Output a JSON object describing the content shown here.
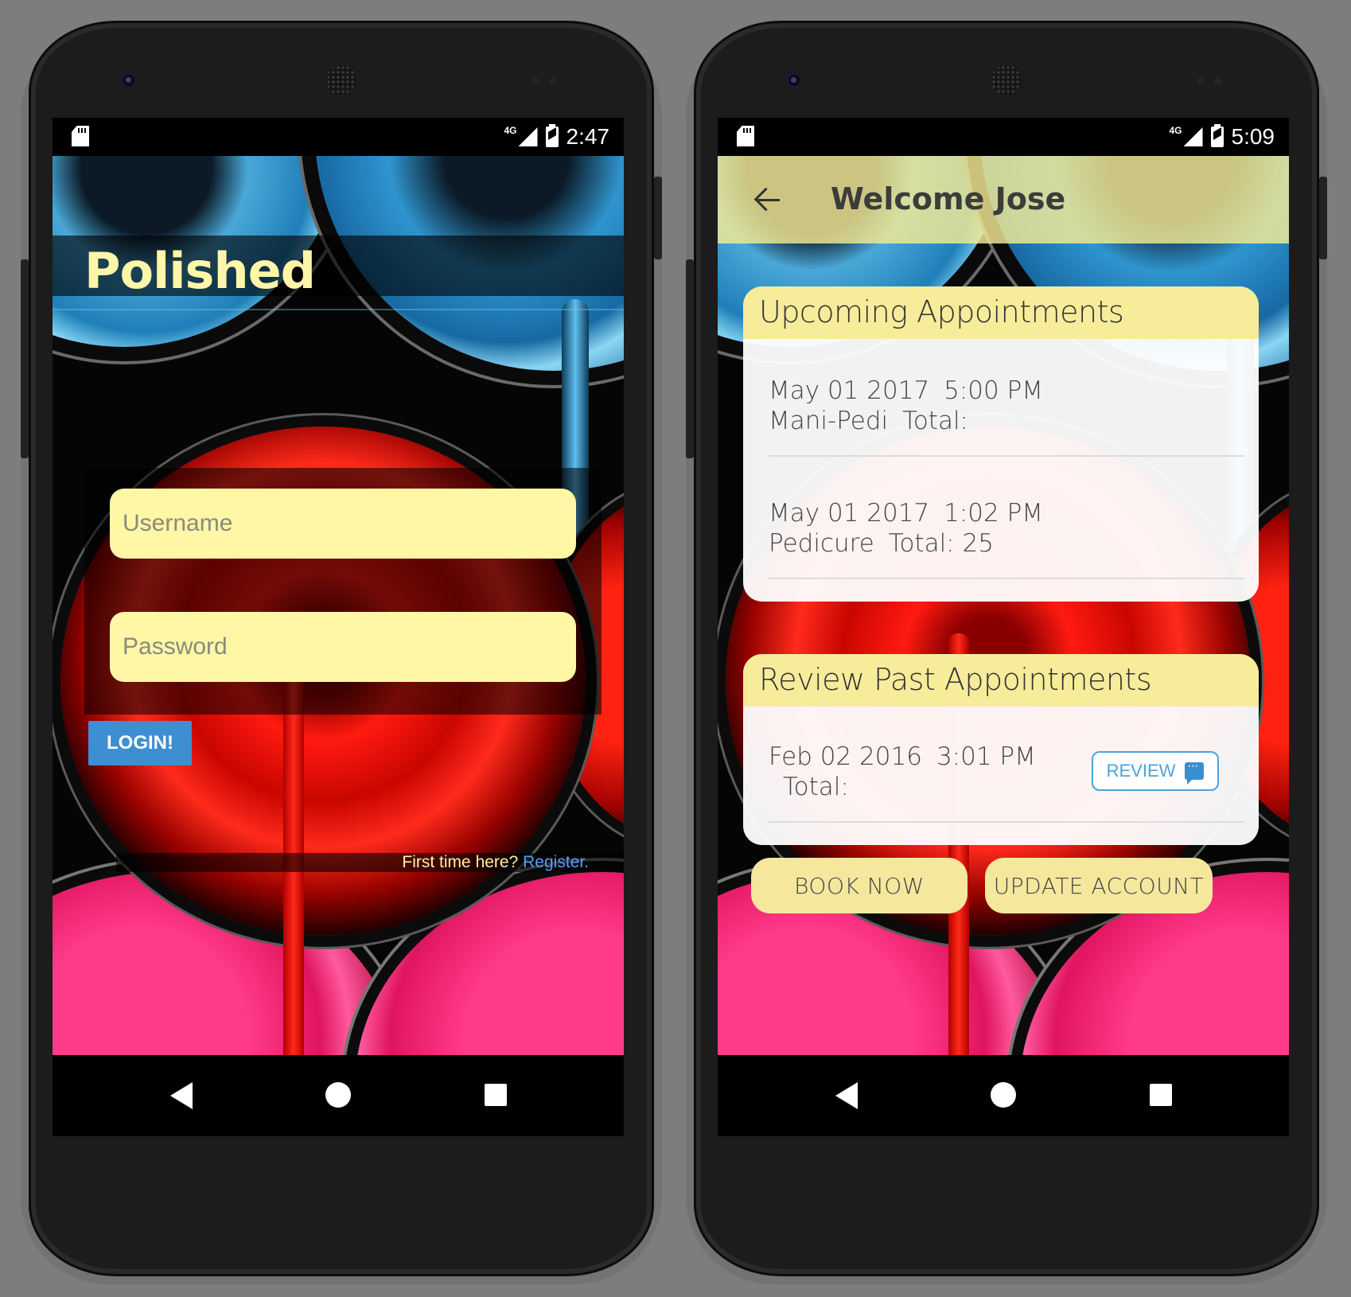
{
  "left_phone": {
    "status": {
      "network": "4G",
      "time": "2:47"
    },
    "app_title": "Polished",
    "username_placeholder": "Username",
    "password_placeholder": "Password",
    "login_label": "LOGIN!",
    "register_prompt": "First time here?",
    "register_link": "Register."
  },
  "right_phone": {
    "status": {
      "network": "4G",
      "time": "5:09"
    },
    "toolbar_title": "Welcome Jose",
    "upcoming": {
      "header": "Upcoming Appointments",
      "items": [
        {
          "date": "May 01 2017",
          "time": "5:00 PM",
          "service": "Mani-Pedi",
          "total": "Total:"
        },
        {
          "date": "May 01 2017",
          "time": "1:02 PM",
          "service": "Pedicure",
          "total": "Total: 25"
        }
      ]
    },
    "past": {
      "header": "Review Past Appointments",
      "items": [
        {
          "date": "Feb 02 2016",
          "time": "3:01 PM",
          "total": "Total:",
          "review_label": "REVIEW"
        }
      ]
    },
    "book_label": "BOOK NOW",
    "update_label": "UPDATE ACCOUNT"
  },
  "colors": {
    "accent_yellow": "#fff7a6",
    "card_header": "#f7ec9a",
    "login_button": "#3d8fd1",
    "register_link": "#5a9cff",
    "review_outline": "#4aa4d8"
  },
  "icons": [
    "sd-card-icon",
    "signal-icon",
    "battery-icon",
    "back-arrow-icon",
    "chat-icon",
    "nav-back-icon",
    "nav-home-icon",
    "nav-recent-icon"
  ]
}
